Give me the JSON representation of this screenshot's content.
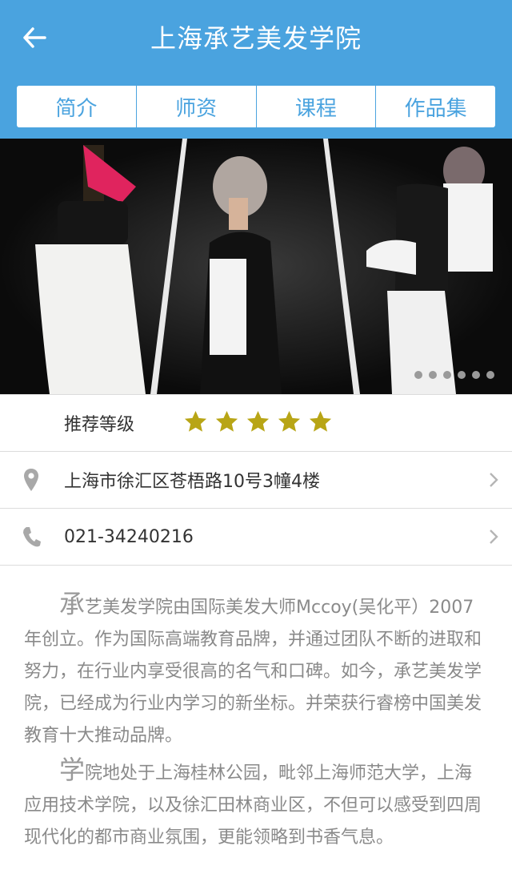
{
  "header": {
    "title": "上海承艺美发学院",
    "back_icon": "arrow-left-icon"
  },
  "tabs": [
    {
      "label": "简介"
    },
    {
      "label": "师资"
    },
    {
      "label": "课程"
    },
    {
      "label": "作品集"
    }
  ],
  "colors": {
    "accent": "#4aa3df",
    "star": "#b8a516",
    "text_muted": "#8a8a8a"
  },
  "banner": {
    "slides_total": 6
  },
  "rating": {
    "label": "推荐等级",
    "stars": 5,
    "max": 5
  },
  "address": {
    "icon": "location-pin-icon",
    "text": "上海市徐汇区苍梧路10号3幢4楼"
  },
  "phone": {
    "icon": "phone-icon",
    "text": "021-34240216"
  },
  "description": {
    "p1_first": "承",
    "p1_rest": "艺美发学院由国际美发大师Mccoy(吴化平）2007年创立。作为国际高端教育品牌，并通过团队不断的进取和努力，在行业内享受很高的名气和口碑。如今，承艺美发学院，已经成为行业内学习的新坐标。并荣获行睿榜中国美发教育十大推动品牌。",
    "p2_first": "学",
    "p2_rest": "院地处于上海桂林公园，毗邻上海师范大学，上海应用技术学院，以及徐汇田林商业区，不但可以感受到四周现代化的都市商业氛围，更能领略到书香气息。"
  }
}
